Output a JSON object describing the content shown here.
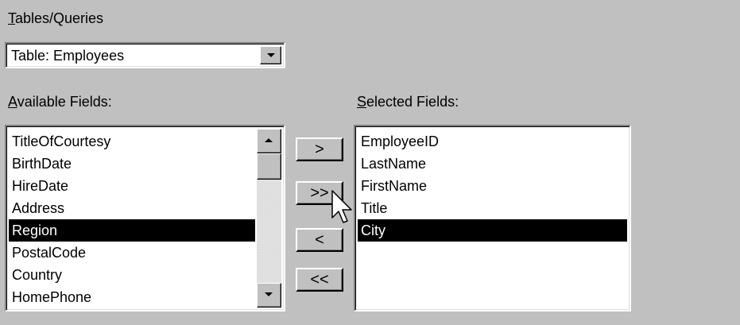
{
  "tables_queries": {
    "label": "Tables/Queries",
    "selected": "Table: Employees"
  },
  "available_fields": {
    "label": "Available Fields:",
    "items": [
      "TitleOfCourtesy",
      "BirthDate",
      "HireDate",
      "Address",
      "Region",
      "PostalCode",
      "Country",
      "HomePhone"
    ],
    "selected_item": "Region"
  },
  "selected_fields": {
    "label": "Selected Fields:",
    "items": [
      "EmployeeID",
      "LastName",
      "FirstName",
      "Title",
      "City"
    ],
    "selected_item": "City"
  },
  "buttons": {
    "add_one": ">",
    "add_all": ">>",
    "remove_one": "<",
    "remove_all": "<<"
  },
  "icons": {
    "dropdown": "chevron-down-icon",
    "scroll_up": "scroll-up-icon",
    "scroll_down": "scroll-down-icon",
    "cursor": "mouse-pointer-icon"
  },
  "colors": {
    "dialog_background": "#c0c0c0",
    "selection_background": "#000000",
    "selection_text": "#ffffff"
  }
}
